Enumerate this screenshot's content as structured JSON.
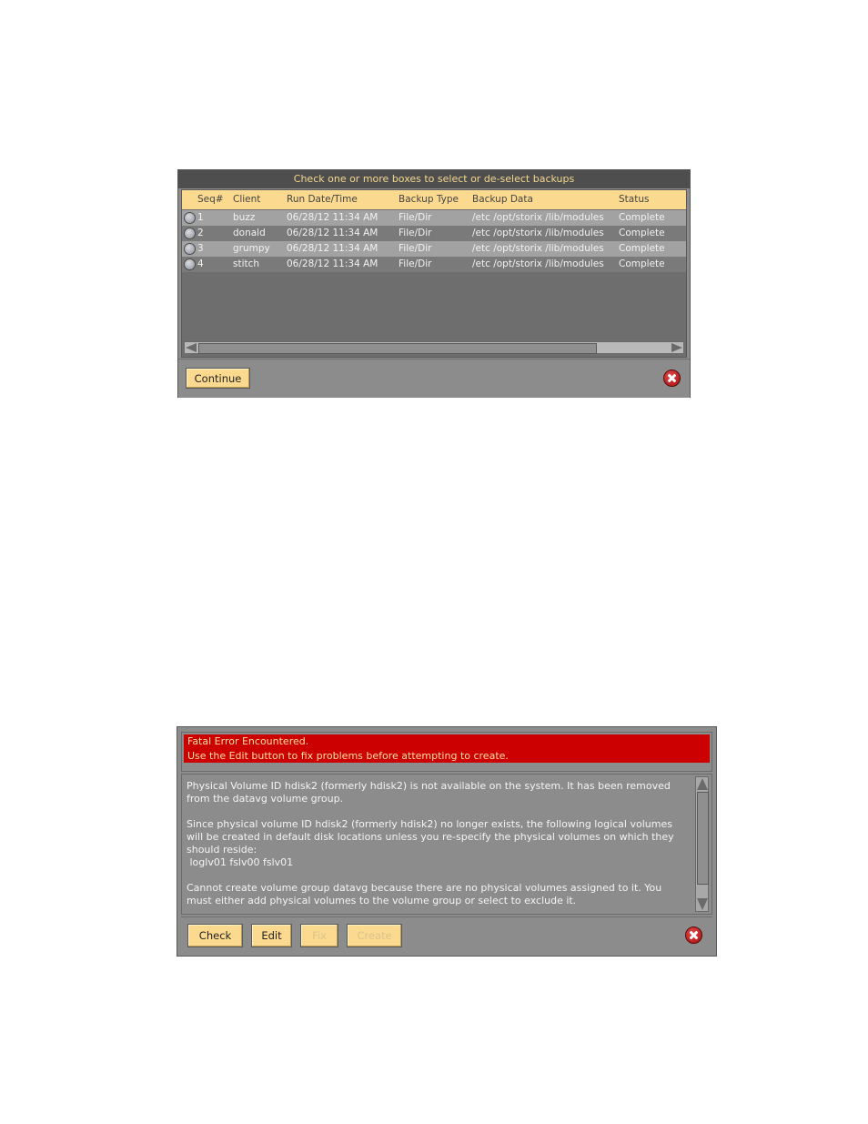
{
  "backup_dialog": {
    "title": "Check one or more boxes to select or de-select backups",
    "columns": [
      "Seq#",
      "Client",
      "Run Date/Time",
      "Backup Type",
      "Backup Data",
      "Status"
    ],
    "rows": [
      {
        "seq": "1",
        "client": "buzz",
        "date": "06/28/12 11:34 AM",
        "type": "File/Dir",
        "data": "/etc /opt/storix /lib/modules",
        "status": "Complete"
      },
      {
        "seq": "2",
        "client": "donald",
        "date": "06/28/12 11:34 AM",
        "type": "File/Dir",
        "data": "/etc /opt/storix /lib/modules",
        "status": "Complete"
      },
      {
        "seq": "3",
        "client": "grumpy",
        "date": "06/28/12 11:34 AM",
        "type": "File/Dir",
        "data": "/etc /opt/storix /lib/modules",
        "status": "Complete"
      },
      {
        "seq": "4",
        "client": "stitch",
        "date": "06/28/12 11:34 AM",
        "type": "File/Dir",
        "data": "/etc /opt/storix /lib/modules",
        "status": "Complete"
      }
    ],
    "continue_label": "Continue",
    "close_icon": "close-icon"
  },
  "error_dialog": {
    "error_line1": "Fatal Error Encountered.",
    "error_line2": "Use the Edit button to fix problems before attempting to create.",
    "message": "Physical Volume ID hdisk2 (formerly hdisk2) is not available on the system. It has been removed\nfrom the datavg volume group.\n\nSince physical volume ID hdisk2 (formerly hdisk2) no longer exists, the following logical volumes\nwill be created in default disk locations unless you re-specify the physical volumes on which they\nshould reside:\n loglv01 fslv00 fslv01\n\nCannot create volume group datavg because there are no physical volumes assigned to it. You\nmust either add physical volumes to the volume group or select to exclude it.",
    "buttons": {
      "check": "Check",
      "edit": "Edit",
      "fix": "Fix",
      "create": "Create"
    },
    "colors": {
      "error_bg": "#cc0000",
      "button_bg": "#fbd98f"
    }
  }
}
